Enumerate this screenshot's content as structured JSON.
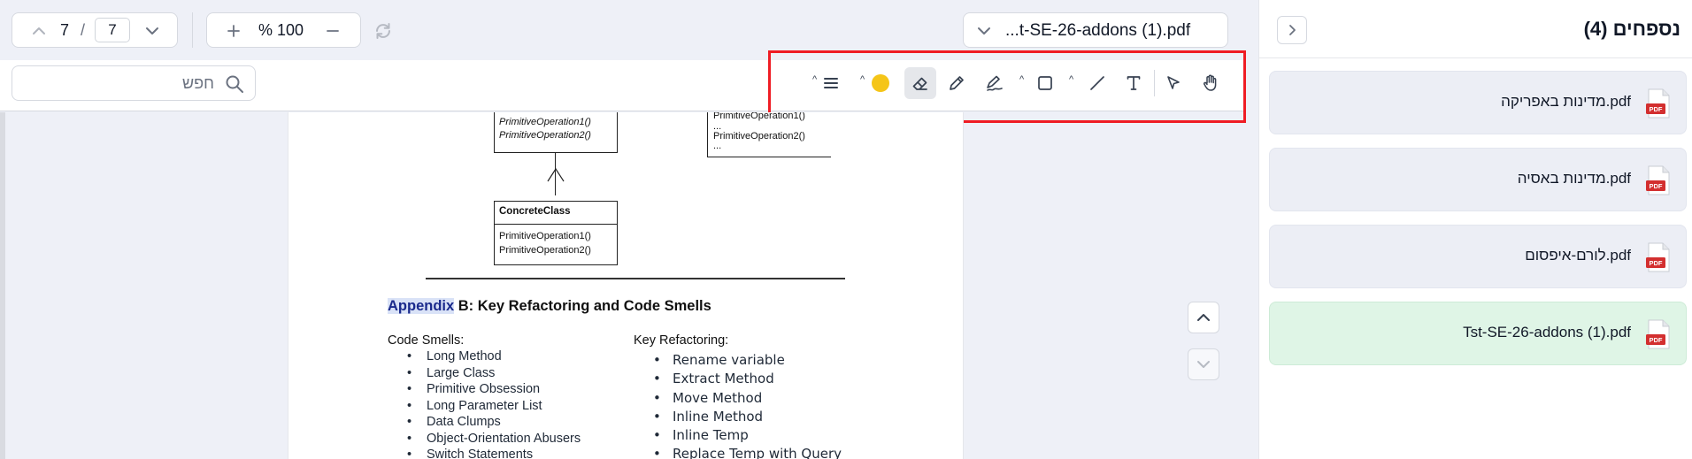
{
  "topbar": {
    "page_current": "7",
    "page_separator": "/",
    "page_total": "7",
    "zoom_label": "% 100",
    "file_name": "...t-SE-26-addons (1).pdf"
  },
  "search": {
    "placeholder": "חפש",
    "value": ""
  },
  "toolbar": {
    "tools": [
      "menu-icon",
      "color-picker",
      "eraser-icon",
      "pen-icon",
      "signature-icon",
      "rectangle-icon",
      "line-icon",
      "text-icon",
      "select-arrow-icon",
      "hand-icon"
    ],
    "active_tool": "eraser-icon",
    "current_color": "#f5c518",
    "highlight_frame_color": "#ef1c24"
  },
  "document": {
    "uml_left_method1": "PrimitiveOperation1()",
    "uml_left_method2": "PrimitiveOperation2()",
    "uml_right_method1": "PrimitiveOperation1()",
    "uml_right_dots1": "...",
    "uml_right_method2": "PrimitiveOperation2()",
    "uml_right_dots2": "...",
    "concrete_class": "ConcreteClass",
    "concrete_method1": "PrimitiveOperation1()",
    "concrete_method2": "PrimitiveOperation2()",
    "appendix_word": "Appendix",
    "appendix_rest": " B:  Key Refactoring and Code Smells",
    "code_smells_title": "Code Smells:",
    "code_smells": [
      "Long Method",
      "Large Class",
      "Primitive Obsession",
      "Long Parameter List",
      "Data Clumps",
      "Object-Orientation Abusers",
      "Switch Statements"
    ],
    "refactoring_title": "Key Refactoring:",
    "refactorings": [
      "Rename variable",
      "Extract Method",
      "Move Method",
      "Inline Method",
      "Inline Temp",
      "Replace Temp with Query"
    ]
  },
  "attachments": {
    "title": "נספחים (4)",
    "files": [
      {
        "name": "מדינות באפריקה.pdf",
        "selected": false
      },
      {
        "name": "מדינות באסיה.pdf",
        "selected": false
      },
      {
        "name": "לורם-איפסום.pdf",
        "selected": false
      },
      {
        "name": "Tst-SE-26-addons (1).pdf",
        "selected": true
      }
    ],
    "pdf_icon_label": "PDF"
  }
}
